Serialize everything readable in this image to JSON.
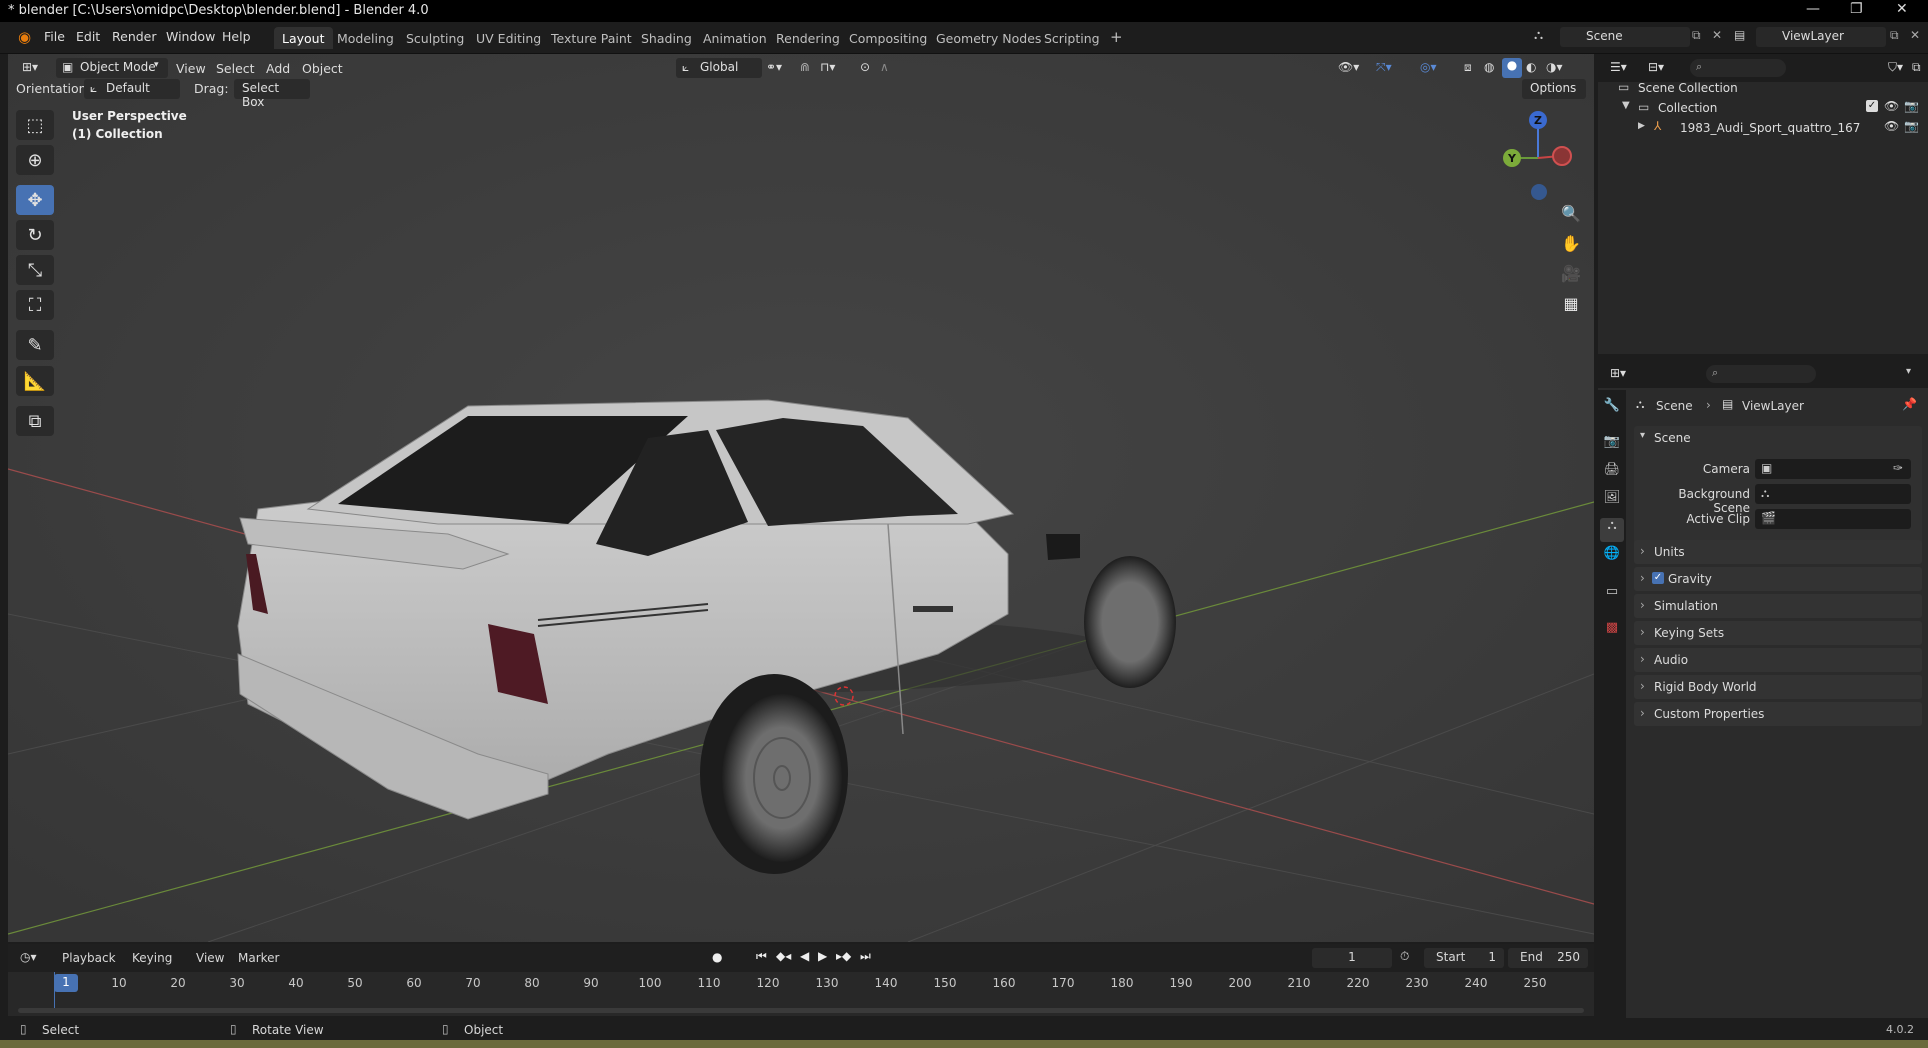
{
  "window": {
    "title": "* blender [C:\\Users\\omidpc\\Desktop\\blender.blend] - Blender 4.0",
    "controls": [
      "—",
      "❐",
      "✕"
    ]
  },
  "menu": [
    "File",
    "Edit",
    "Render",
    "Window",
    "Help"
  ],
  "workspaces": [
    "Layout",
    "Modeling",
    "Sculpting",
    "UV Editing",
    "Texture Paint",
    "Shading",
    "Animation",
    "Rendering",
    "Compositing",
    "Geometry Nodes",
    "Scripting"
  ],
  "workspace_add": "+",
  "scene_selector": "Scene",
  "viewlayer_selector": "ViewLayer",
  "viewport_header": {
    "mode": "Object Mode",
    "menus": [
      "View",
      "Select",
      "Add",
      "Object"
    ],
    "transform_orientation": "Global"
  },
  "tool_settings": {
    "orientation_label": "Orientation:",
    "orientation_value": "Default",
    "drag_label": "Drag:",
    "drag_value": "Select Box",
    "options": "Options"
  },
  "viewport": {
    "perspective": "User Perspective",
    "collection": "(1) Collection",
    "gizmo": {
      "z": "Z",
      "y": "Y"
    }
  },
  "outliner": {
    "root": "Scene Collection",
    "collection": "Collection",
    "object": "1983_Audi_Sport_quattro_167"
  },
  "properties": {
    "breadcrumb_scene": "Scene",
    "breadcrumb_viewlayer": "ViewLayer",
    "panel_scene": "Scene",
    "fields": [
      "Camera",
      "Background Scene",
      "Active Clip"
    ],
    "panels": [
      "Units",
      "Gravity",
      "Simulation",
      "Keying Sets",
      "Audio",
      "Rigid Body World",
      "Custom Properties"
    ]
  },
  "timeline": {
    "menus": [
      "Playback",
      "Keying",
      "View",
      "Marker"
    ],
    "current_frame": "1",
    "start_label": "Start",
    "start_value": "1",
    "end_label": "End",
    "end_value": "250",
    "ticks": [
      "1",
      "10",
      "20",
      "30",
      "40",
      "50",
      "60",
      "70",
      "80",
      "90",
      "100",
      "110",
      "120",
      "130",
      "140",
      "150",
      "160",
      "170",
      "180",
      "190",
      "200",
      "210",
      "220",
      "230",
      "240",
      "250"
    ]
  },
  "status": {
    "select": "Select",
    "rotate": "Rotate View",
    "object": "Object",
    "version": "4.0.2"
  },
  "colors": {
    "accent": "#4772b3",
    "viewport_bg": "#3b3b3b",
    "panel_bg": "#2b2b2b"
  }
}
